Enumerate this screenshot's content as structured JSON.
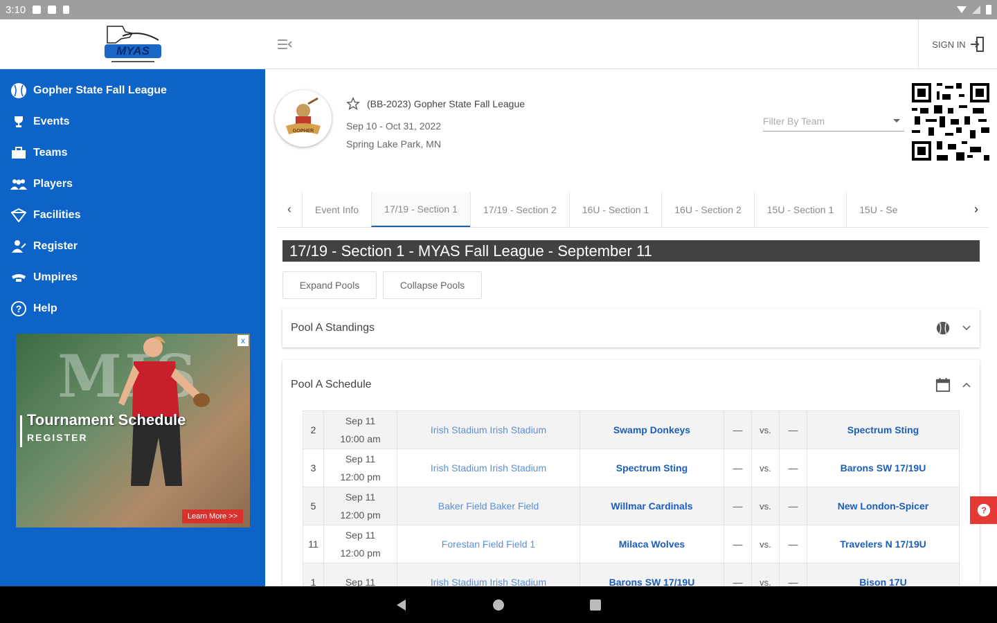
{
  "status_bar": {
    "time": "3:10"
  },
  "sidebar": {
    "logo_alt": "MYAS",
    "items": [
      {
        "label": "Gopher State Fall League",
        "icon": "baseball-icon"
      },
      {
        "label": "Events",
        "icon": "trophy-icon"
      },
      {
        "label": "Teams",
        "icon": "teams-icon"
      },
      {
        "label": "Players",
        "icon": "players-icon"
      },
      {
        "label": "Facilities",
        "icon": "facilities-icon"
      },
      {
        "label": "Register",
        "icon": "register-icon"
      },
      {
        "label": "Umpires",
        "icon": "umpire-icon"
      },
      {
        "label": "Help",
        "icon": "help-icon"
      }
    ],
    "ad": {
      "bg_text": "MIS",
      "title": "Tournament Schedule",
      "register": "REGISTER",
      "learn_more": "Learn More >>",
      "close": "x"
    }
  },
  "topbar": {
    "sign_in": "SIGN IN"
  },
  "event": {
    "title": "(BB-2023) Gopher State Fall League",
    "dates": "Sep 10 - Oct 31, 2022",
    "location": "Spring Lake Park, MN",
    "filter_placeholder": "Filter By Team"
  },
  "tabs": [
    {
      "label": "Event Info",
      "active": false
    },
    {
      "label": "17/19 - Section 1",
      "active": true
    },
    {
      "label": "17/19 - Section 2",
      "active": false
    },
    {
      "label": "16U - Section 1",
      "active": false
    },
    {
      "label": "16U - Section 2",
      "active": false
    },
    {
      "label": "15U - Section 1",
      "active": false
    },
    {
      "label": "15U - Se",
      "active": false
    }
  ],
  "section_title": "17/19 - Section 1 - MYAS Fall League - September 11",
  "buttons": {
    "expand": "Expand Pools",
    "collapse": "Collapse Pools"
  },
  "pools": {
    "standings_title": "Pool A Standings",
    "schedule_title": "Pool A Schedule"
  },
  "schedule": [
    {
      "game": "2",
      "date": "Sep 11",
      "time": "10:00 am",
      "venue": "Irish Stadium Irish Stadium",
      "home": "Swamp Donkeys",
      "home_score": "—",
      "vs": "vs.",
      "away_score": "—",
      "away": "Spectrum Sting"
    },
    {
      "game": "3",
      "date": "Sep 11",
      "time": "12:00 pm",
      "venue": "Irish Stadium Irish Stadium",
      "home": "Spectrum Sting",
      "home_score": "—",
      "vs": "vs.",
      "away_score": "—",
      "away": "Barons SW 17/19U"
    },
    {
      "game": "5",
      "date": "Sep 11",
      "time": "12:00 pm",
      "venue": "Baker Field Baker Field",
      "home": "Willmar Cardinals",
      "home_score": "—",
      "vs": "vs.",
      "away_score": "—",
      "away": "New London-Spicer"
    },
    {
      "game": "11",
      "date": "Sep 11",
      "time": "12:00 pm",
      "venue": "Forestan Field Field 1",
      "home": "Milaca Wolves",
      "home_score": "—",
      "vs": "vs.",
      "away_score": "—",
      "away": "Travelers N 17/19U"
    },
    {
      "game": "1",
      "date": "Sep 11",
      "time": "",
      "venue": "Irish Stadium Irish Stadium",
      "home": "Barons SW 17/19U",
      "home_score": "—",
      "vs": "vs.",
      "away_score": "—",
      "away": "Bison 17U"
    }
  ],
  "colors": {
    "sidebar": "#0d63c7",
    "section_header": "#424242",
    "team_link": "#1b5dbd",
    "help_button": "#e53935"
  }
}
